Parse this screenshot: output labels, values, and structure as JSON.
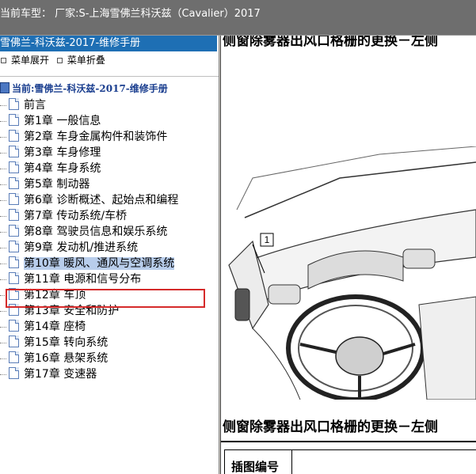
{
  "topbar": {
    "title": "当前车型：  厂家:S-上海雪佛兰科沃兹（Cavalier）2017"
  },
  "left_panel": {
    "header": "雪佛兰-科沃兹-2017-维修手册",
    "expand_label": "菜单展开",
    "collapse_label": "菜单折叠",
    "root_label": "当前:雪佛兰-科沃兹-2017-维修手册",
    "items": [
      "前言",
      "第1章 一般信息",
      "第2章 车身金属构件和装饰件",
      "第3章 车身修理",
      "第4章 车身系统",
      "第5章 制动器",
      "第6章 诊断概述、起始点和编程",
      "第7章 传动系统/车桥",
      "第8章 驾驶员信息和娱乐系统",
      "第9章 发动机/推进系统",
      "第10章 暖风、通风与空调系统",
      "第11章 电源和信号分布",
      "第12章 车顶",
      "第13章 安全和防护",
      "第14章 座椅",
      "第15章 转向系统",
      "第16章 悬架系统",
      "第17章 变速器"
    ],
    "selected_index": 10
  },
  "right_panel": {
    "heading_top": "侧窗除雾器出风口格栅的更换－左侧",
    "callout_number": "1",
    "heading_bottom": "侧窗除雾器出风口格栅的更换－左侧",
    "table_header": "插图编号"
  },
  "colors": {
    "topbar": "#6e6e6e",
    "header_blue": "#1e6fb4",
    "selection": "#b8cdeb",
    "highlight_box": "#d52a2a"
  }
}
